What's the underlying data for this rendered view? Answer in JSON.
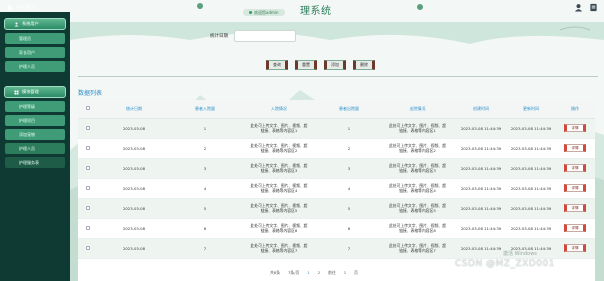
{
  "topbar": {
    "home_label": "后台首页",
    "user_label": "欢迎您admin",
    "title_visible": "理系统",
    "right_icons": [
      "user-icon",
      "logout-icon"
    ]
  },
  "sidebar": {
    "groups": [
      {
        "label": "系统用户",
        "icon": "person-icon",
        "items": [
          {
            "label": "管理员",
            "state": "normal"
          },
          {
            "label": "家长用户",
            "state": "normal"
          },
          {
            "label": "护理人员",
            "state": "normal"
          }
        ]
      },
      {
        "label": "模块管理",
        "icon": "grid-icon",
        "items": [
          {
            "label": "护理等级",
            "state": "normal"
          },
          {
            "label": "护理项目",
            "state": "normal"
          },
          {
            "label": "添加宠物",
            "state": "normal"
          },
          {
            "label": "护理人员",
            "state": "active"
          },
          {
            "label": "护理服务表",
            "state": "dark"
          }
        ]
      }
    ]
  },
  "filter": {
    "label": "统计日期",
    "value": "",
    "placeholder": ""
  },
  "buttons": {
    "query": "查询",
    "reset": "重置",
    "add": "添加",
    "delete": "删除"
  },
  "section_title": "数据列表",
  "table": {
    "columns": [
      "统计日期",
      "患者入院量",
      "入院情况",
      "患者出院量",
      "出院情况",
      "创建时间",
      "更新时间",
      "操作"
    ],
    "rows": [
      {
        "date": "2023-03-08",
        "in_count": "1",
        "in_desc": "此处可上传文字、图片、视频、超链接、表格等内容区1",
        "out_count": "1",
        "out_desc": "此处可上传文字、图片、视频、超链接、表格等内容区1",
        "created": "2023-03-08 11:44:39",
        "updated": "2023-03-08 11:44:39",
        "action": "详情"
      },
      {
        "date": "2023-03-08",
        "in_count": "2",
        "in_desc": "此处可上传文字、图片、视频、超链接、表格等内容区2",
        "out_count": "2",
        "out_desc": "此处可上传文字、图片、视频、超链接、表格等内容区2",
        "created": "2023-03-08 11:44:39",
        "updated": "2023-03-08 11:44:39",
        "action": "详情"
      },
      {
        "date": "2023-03-08",
        "in_count": "3",
        "in_desc": "此处可上传文字、图片、视频、超链接、表格等内容区3",
        "out_count": "3",
        "out_desc": "此处可上传文字、图片、视频、超链接、表格等内容区3",
        "created": "2023-03-08 11:44:39",
        "updated": "2023-03-08 11:44:39",
        "action": "详情"
      },
      {
        "date": "2023-03-08",
        "in_count": "4",
        "in_desc": "此处可上传文字、图片、视频、超链接、表格等内容区4",
        "out_count": "4",
        "out_desc": "此处可上传文字、图片、视频、超链接、表格等内容区4",
        "created": "2023-03-08 11:44:39",
        "updated": "2023-03-08 11:44:39",
        "action": "详情"
      },
      {
        "date": "2023-03-08",
        "in_count": "5",
        "in_desc": "此处可上传文字、图片、视频、超链接、表格等内容区5",
        "out_count": "5",
        "out_desc": "此处可上传文字、图片、视频、超链接、表格等内容区5",
        "created": "2023-03-08 11:44:39",
        "updated": "2023-03-08 11:44:39",
        "action": "详情"
      },
      {
        "date": "2023-03-08",
        "in_count": "6",
        "in_desc": "此处可上传文字、图片、视频、超链接、表格等内容区6",
        "out_count": "6",
        "out_desc": "此处可上传文字、图片、视频、超链接、表格等内容区6",
        "created": "2023-03-08 11:44:39",
        "updated": "2023-03-08 11:44:39",
        "action": "详情"
      },
      {
        "date": "2023-03-08",
        "in_count": "7",
        "in_desc": "此处可上传文字、图片、视频、超链接、表格等内容区7",
        "out_count": "7",
        "out_desc": "此处可上传文字、图片、视频、超链接、表格等内容区7",
        "created": "2023-03-08 11:44:39",
        "updated": "2023-03-08 11:44:39",
        "action": "详情"
      }
    ]
  },
  "pagination": {
    "total": "共8条",
    "page_size": "7条/页",
    "pages": [
      "1",
      "2"
    ],
    "goto_label": "前往",
    "goto_value": "1",
    "page_suffix": "页"
  },
  "overlay": {
    "windows_watermark": "激活 Windows",
    "csdn_mark": "CSDN @MZ_ZXD001"
  },
  "colors": {
    "sidebar_bg": "#0e3a33",
    "menu_green": "#3f9c76",
    "header_blue": "#2f8fc9",
    "action_red": "#d24a3a"
  }
}
